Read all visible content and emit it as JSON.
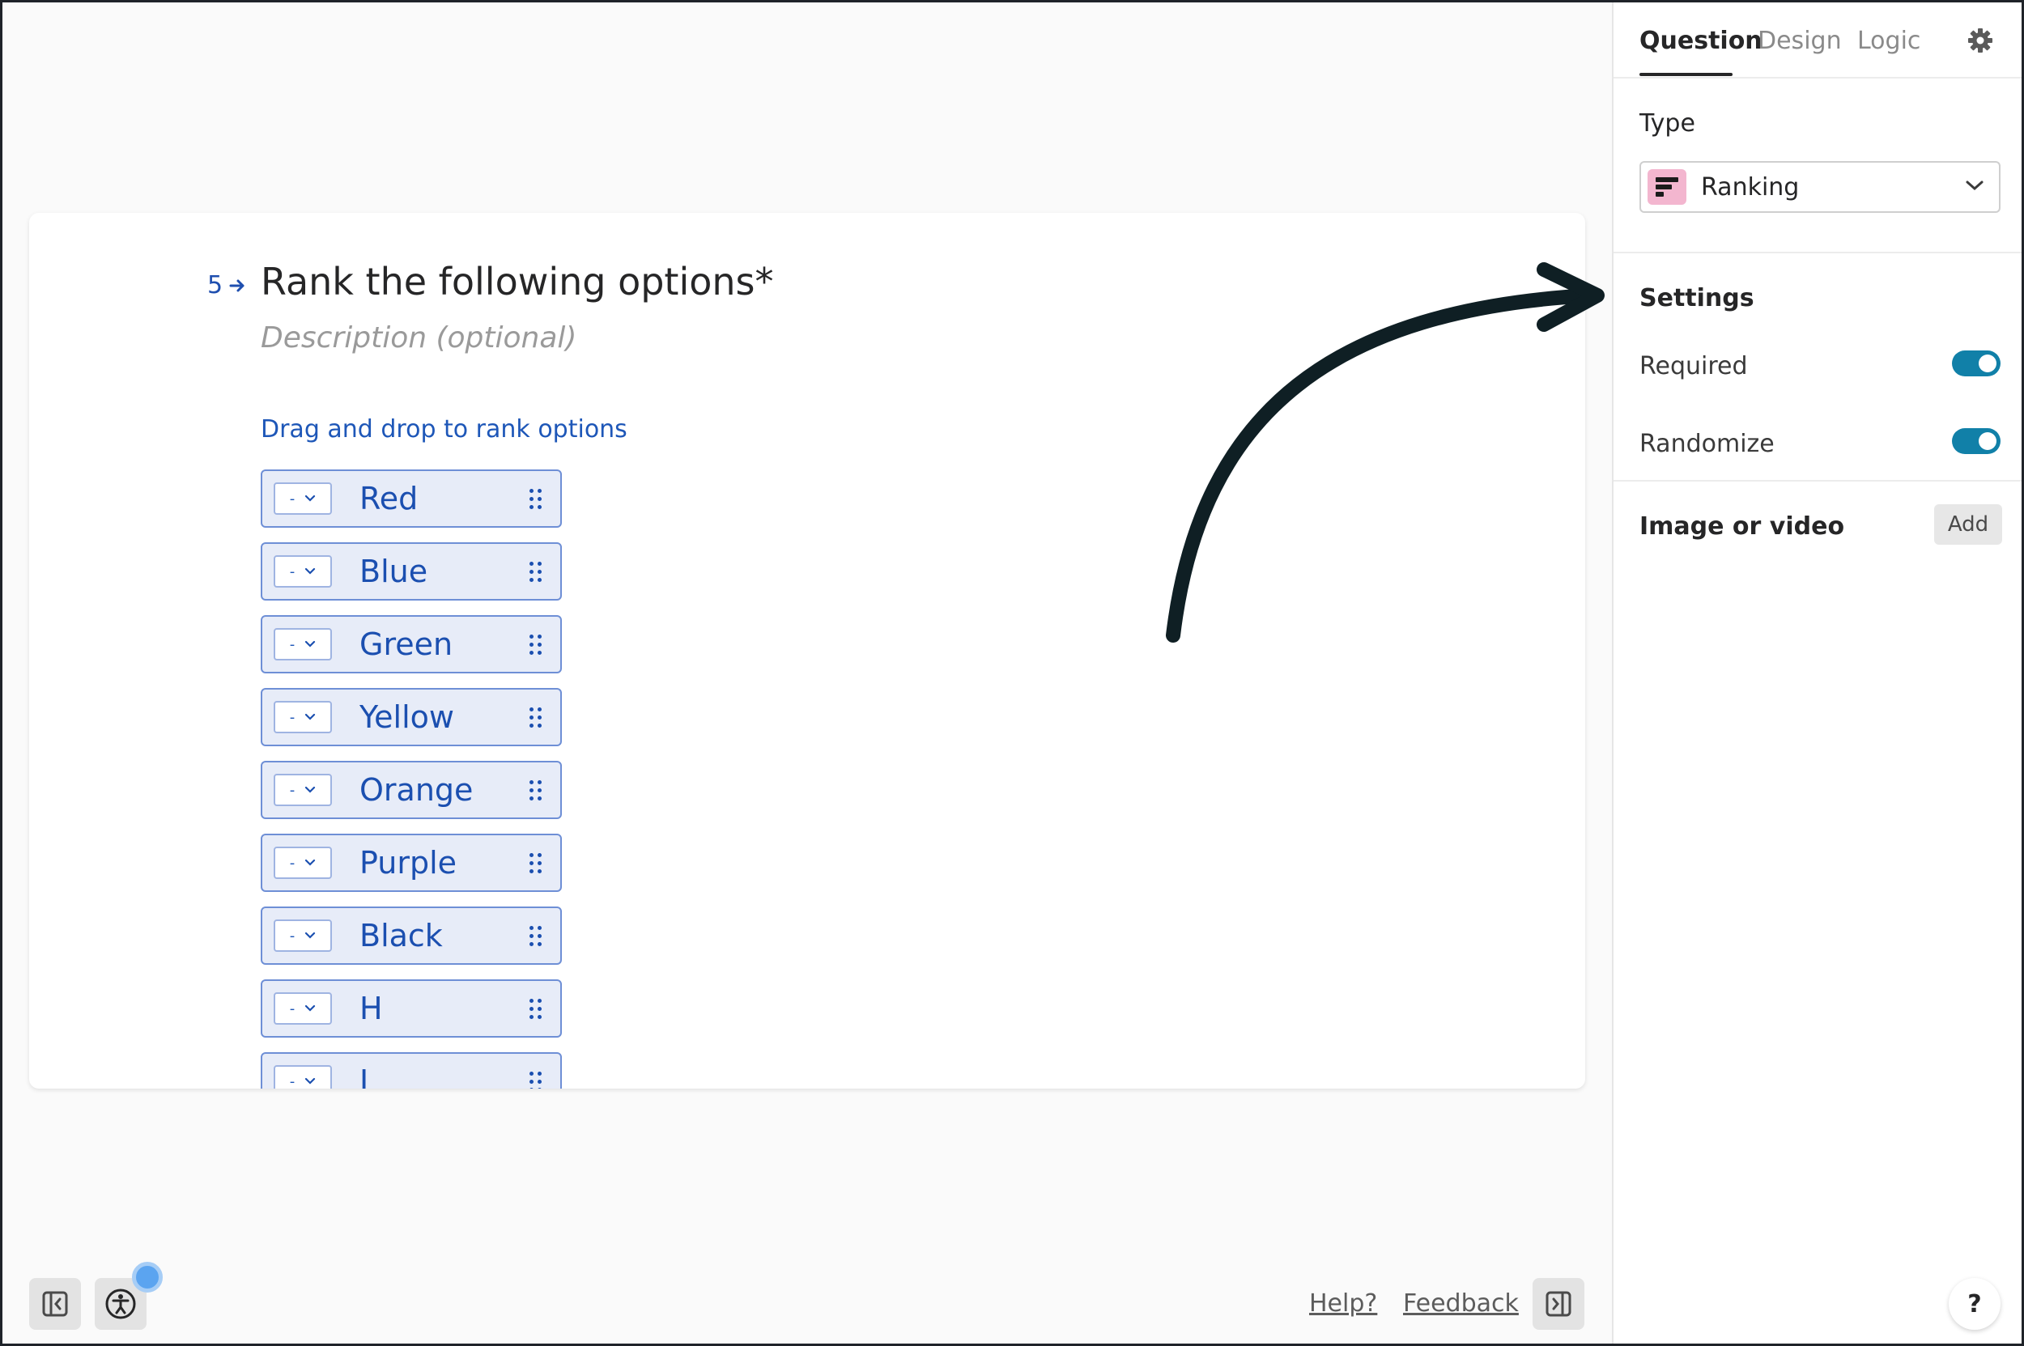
{
  "question": {
    "number": "5",
    "title": "Rank the following options*",
    "description_placeholder": "Description (optional)",
    "hint": "Drag and drop to rank options",
    "rank_placeholder": "-",
    "options": [
      {
        "label": "Red"
      },
      {
        "label": "Blue"
      },
      {
        "label": "Green"
      },
      {
        "label": "Yellow"
      },
      {
        "label": "Orange"
      },
      {
        "label": "Purple"
      },
      {
        "label": "Black"
      },
      {
        "label": "H"
      },
      {
        "label": "I"
      }
    ]
  },
  "footer": {
    "help_label": "Help?",
    "feedback_label": "Feedback",
    "icons": [
      "collapse-left-panel-icon",
      "accessibility-icon",
      "collapse-right-panel-icon"
    ]
  },
  "panel": {
    "tabs": [
      {
        "label": "Question",
        "active": true
      },
      {
        "label": "Design",
        "active": false
      },
      {
        "label": "Logic",
        "active": false
      }
    ],
    "type_label": "Type",
    "type_value": "Ranking",
    "settings_label": "Settings",
    "settings": [
      {
        "label": "Required",
        "enabled": true
      },
      {
        "label": "Randomize",
        "enabled": true
      }
    ],
    "media_label": "Image or video",
    "media_add": "Add",
    "help_fab": "?"
  },
  "colors": {
    "accent": "#1180a8",
    "option_text": "#1b4fb0",
    "option_bg": "#e7ecf8",
    "option_border": "#6e8fd6",
    "type_icon_bg": "#f3b6cf",
    "annotation_arrow": "#0f1f24"
  }
}
